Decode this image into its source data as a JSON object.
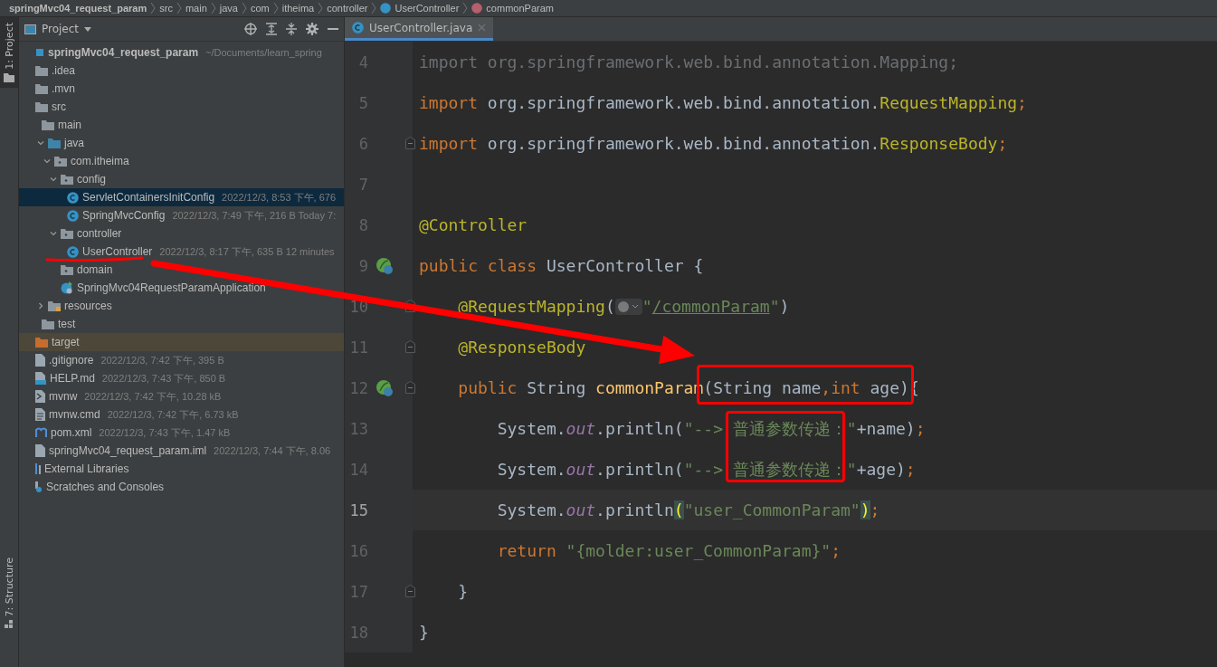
{
  "breadcrumbs": [
    {
      "label": "springMvc04_request_param",
      "kind": "project"
    },
    {
      "label": "src",
      "kind": "folder"
    },
    {
      "label": "main",
      "kind": "folder"
    },
    {
      "label": "java",
      "kind": "folder"
    },
    {
      "label": "com",
      "kind": "folder"
    },
    {
      "label": "itheima",
      "kind": "folder"
    },
    {
      "label": "controller",
      "kind": "folder"
    },
    {
      "label": "UserController",
      "kind": "class"
    },
    {
      "label": "commonParam",
      "kind": "method"
    }
  ],
  "tool_strip": {
    "top": "1: Project",
    "bottom": "7: Structure"
  },
  "project_panel": {
    "title": "Project",
    "tree": [
      {
        "name": "springMvc04_request_param",
        "kind": "module",
        "meta": "~/Documents/learn_spring",
        "selected": false,
        "children": [
          {
            "name": ".idea",
            "kind": "folder",
            "selected": false
          },
          {
            "name": ".mvn",
            "kind": "folder",
            "selected": false
          },
          {
            "name": "src",
            "kind": "folder",
            "selected": false,
            "children": [
              {
                "name": "main",
                "kind": "folder",
                "selected": false,
                "children": [
                  {
                    "name": "java",
                    "kind": "source-folder",
                    "expanded": true,
                    "selected": false,
                    "children": [
                      {
                        "name": "com.itheima",
                        "kind": "package",
                        "expanded": true,
                        "selected": false,
                        "children": [
                          {
                            "name": "config",
                            "kind": "package",
                            "expanded": true,
                            "selected": false,
                            "children": [
                              {
                                "name": "ServletContainersInitConfig",
                                "kind": "class",
                                "meta": "2022/12/3, 8:53 下午, 676",
                                "selected": true
                              },
                              {
                                "name": "SpringMvcConfig",
                                "kind": "class",
                                "meta": "2022/12/3, 7:49 下午, 216 B Today 7:",
                                "selected": false
                              }
                            ]
                          },
                          {
                            "name": "controller",
                            "kind": "package",
                            "expanded": true,
                            "selected": false,
                            "children": [
                              {
                                "name": "UserController",
                                "kind": "class",
                                "meta": "2022/12/3, 8:17 下午, 635 B 12 minutes",
                                "selected": false
                              }
                            ]
                          },
                          {
                            "name": "domain",
                            "kind": "package",
                            "selected": false
                          },
                          {
                            "name": "SpringMvc04RequestParamApplication",
                            "kind": "spring-app",
                            "selected": false
                          }
                        ]
                      }
                    ]
                  },
                  {
                    "name": "resources",
                    "kind": "resource-folder",
                    "expanded": false,
                    "selected": false
                  }
                ]
              },
              {
                "name": "test",
                "kind": "folder",
                "selected": false
              }
            ]
          },
          {
            "name": "target",
            "kind": "excluded-folder",
            "selected": false
          },
          {
            "name": ".gitignore",
            "kind": "ignore-file",
            "meta": "2022/12/3, 7:42 下午, 395 B",
            "selected": false
          },
          {
            "name": "HELP.md",
            "kind": "markdown",
            "meta": "2022/12/3, 7:43 下午, 850 B",
            "selected": false
          },
          {
            "name": "mvnw",
            "kind": "script",
            "meta": "2022/12/3, 7:42 下午, 10.28 kB",
            "selected": false
          },
          {
            "name": "mvnw.cmd",
            "kind": "text",
            "meta": "2022/12/3, 7:42 下午, 6.73 kB",
            "selected": false
          },
          {
            "name": "pom.xml",
            "kind": "maven",
            "meta": "2022/12/3, 7:43 下午, 1.47 kB",
            "selected": false
          },
          {
            "name": "springMvc04_request_param.iml",
            "kind": "iml",
            "meta": "2022/12/3, 7:44 下午, 8.06",
            "selected": false
          }
        ]
      },
      {
        "name": "External Libraries",
        "kind": "library",
        "selected": false
      },
      {
        "name": "Scratches and Consoles",
        "kind": "scratches",
        "selected": false
      }
    ]
  },
  "editor": {
    "tabs": [
      {
        "label": "UserController.java",
        "selected": true
      }
    ],
    "lines": [
      {
        "number": "4",
        "current": false,
        "tokens": [
          {
            "text": "import org.springframework.web.bind.annotation.Mapping;",
            "kind": "unused"
          }
        ]
      },
      {
        "number": "5",
        "current": false,
        "tokens": [
          {
            "text": "import ",
            "kind": "keyword"
          },
          {
            "text": "org.springframework.web.bind.annotation.",
            "kind": "plain"
          },
          {
            "text": "RequestMapping",
            "kind": "annotation"
          },
          {
            "text": ";",
            "kind": "keyword"
          }
        ]
      },
      {
        "number": "6",
        "current": false,
        "fold": true,
        "tokens": [
          {
            "text": "import ",
            "kind": "keyword"
          },
          {
            "text": "org.springframework.web.bind.annotation.",
            "kind": "plain"
          },
          {
            "text": "ResponseBody",
            "kind": "annotation"
          },
          {
            "text": ";",
            "kind": "keyword"
          }
        ]
      },
      {
        "number": "7",
        "current": false
      },
      {
        "number": "8",
        "current": false,
        "tokens": [
          {
            "text": "@Controller",
            "kind": "annotation"
          }
        ]
      },
      {
        "number": "9",
        "current": false,
        "bean": true,
        "tokens": [
          {
            "text": "public class ",
            "kind": "keyword"
          },
          {
            "text": "UserController {",
            "kind": "plain"
          }
        ]
      },
      {
        "number": "10",
        "current": false,
        "fold": true,
        "tokens": [
          {
            "text": "    @RequestMapping",
            "kind": "annotation"
          },
          {
            "text": "(",
            "kind": "plain"
          },
          {
            "kind": "inlay"
          },
          {
            "text": "\"",
            "kind": "string"
          },
          {
            "text": "/commonParam",
            "kind": "link"
          },
          {
            "text": "\"",
            "kind": "string"
          },
          {
            "text": ")",
            "kind": "plain"
          }
        ]
      },
      {
        "number": "11",
        "current": false,
        "fold": true,
        "tokens": [
          {
            "text": "    @ResponseBody",
            "kind": "annotation"
          }
        ]
      },
      {
        "number": "12",
        "current": false,
        "bean": true,
        "fold": true,
        "tokens": [
          {
            "text": "    public ",
            "kind": "keyword"
          },
          {
            "text": "String ",
            "kind": "plain"
          },
          {
            "text": "commonParam",
            "kind": "method"
          },
          {
            "text": "(String name",
            "kind": "plain"
          },
          {
            "text": ",int ",
            "kind": "keyword"
          },
          {
            "text": "age){",
            "kind": "plain"
          }
        ]
      },
      {
        "number": "13",
        "current": false,
        "tokens": [
          {
            "text": "        System.",
            "kind": "plain"
          },
          {
            "text": "out",
            "kind": "field"
          },
          {
            "text": ".println(",
            "kind": "plain"
          },
          {
            "text": "\"--> 普通参数传递：\"",
            "kind": "string"
          },
          {
            "text": "+name)",
            "kind": "plain"
          },
          {
            "text": ";",
            "kind": "keyword"
          }
        ]
      },
      {
        "number": "14",
        "current": false,
        "tokens": [
          {
            "text": "        System.",
            "kind": "plain"
          },
          {
            "text": "out",
            "kind": "field"
          },
          {
            "text": ".println(",
            "kind": "plain"
          },
          {
            "text": "\"--> 普通参数传递：\"",
            "kind": "string"
          },
          {
            "text": "+age)",
            "kind": "plain"
          },
          {
            "text": ";",
            "kind": "keyword"
          }
        ]
      },
      {
        "number": "15",
        "current": true,
        "tokens": [
          {
            "text": "        System.",
            "kind": "plain"
          },
          {
            "text": "out",
            "kind": "field"
          },
          {
            "text": ".println",
            "kind": "plain"
          },
          {
            "text": "(",
            "kind": "brace"
          },
          {
            "text": "\"user_CommonParam\"",
            "kind": "string"
          },
          {
            "text": ")",
            "kind": "brace"
          },
          {
            "text": ";",
            "kind": "keyword"
          }
        ]
      },
      {
        "number": "16",
        "current": false,
        "tokens": [
          {
            "text": "        return ",
            "kind": "keyword"
          },
          {
            "text": "\"{molder:user_CommonParam}\"",
            "kind": "string"
          },
          {
            "text": ";",
            "kind": "keyword"
          }
        ]
      },
      {
        "number": "17",
        "current": false,
        "fold": true,
        "tokens": [
          {
            "text": "    }",
            "kind": "plain"
          }
        ]
      },
      {
        "number": "18",
        "current": false,
        "tokens": [
          {
            "text": "}",
            "kind": "plain"
          }
        ]
      }
    ]
  },
  "annotations": [
    {
      "kind": "underline"
    },
    {
      "kind": "arrow"
    },
    {
      "kind": "box"
    },
    {
      "kind": "box"
    }
  ]
}
